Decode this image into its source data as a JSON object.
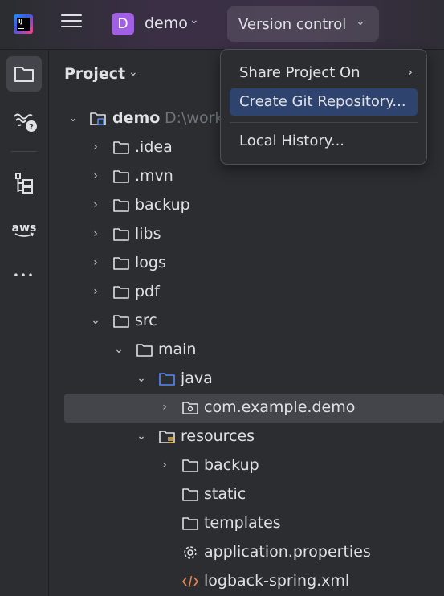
{
  "titlebar": {
    "app_logo_text": "IJ",
    "project_initial": "D",
    "project_name": "demo",
    "vcs_label": "Version control",
    "dropdown_glyph": "⌄"
  },
  "toolstrip": {
    "aws_label": "aws",
    "more_glyph": "•••"
  },
  "panel": {
    "title": "Project"
  },
  "tree": {
    "chevron_collapsed": "›",
    "chevron_expanded": "⌄",
    "root_label": "demo",
    "root_path_hint": "D:\\work",
    "rows": [
      {
        "label": ".idea"
      },
      {
        "label": ".mvn"
      },
      {
        "label": "backup"
      },
      {
        "label": "libs"
      },
      {
        "label": "logs"
      },
      {
        "label": "pdf"
      },
      {
        "label": "src"
      },
      {
        "label": "main"
      },
      {
        "label": "java"
      },
      {
        "label": "com.example.demo"
      },
      {
        "label": "resources"
      },
      {
        "label": "backup"
      },
      {
        "label": "static"
      },
      {
        "label": "templates"
      },
      {
        "label": "application.properties"
      },
      {
        "label": "logback-spring.xml"
      }
    ]
  },
  "vcs_menu": {
    "items": [
      {
        "label": "Share Project On",
        "arrow": "›"
      },
      {
        "label": "Create Git Repository..."
      },
      {
        "label": "Local History..."
      }
    ]
  },
  "colors": {
    "background": "#2b2d30",
    "selection": "#43454a",
    "menu_highlight": "#2e436e",
    "project_badge": "#a160e4",
    "java_folder": "#548af7",
    "xml_icon": "#e8844a"
  }
}
